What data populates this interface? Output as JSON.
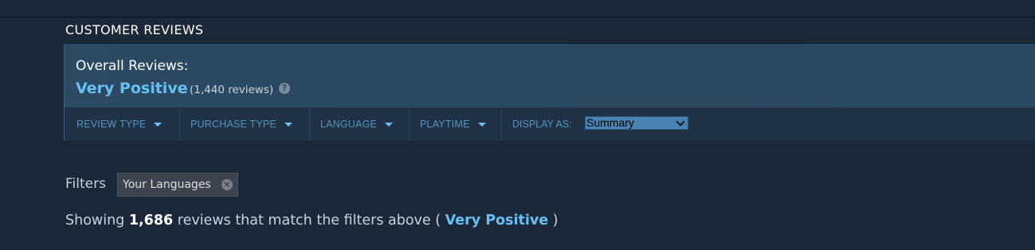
{
  "section": {
    "title": "CUSTOMER REVIEWS"
  },
  "summary": {
    "label": "Overall Reviews:",
    "rating": "Very Positive",
    "count": "(1,440 reviews)",
    "help_icon": "?",
    "rating_color": "#66c0f4"
  },
  "filter_bar": {
    "items": [
      {
        "label": "REVIEW TYPE"
      },
      {
        "label": "PURCHASE TYPE"
      },
      {
        "label": "LANGUAGE"
      },
      {
        "label": "PLAYTIME"
      }
    ],
    "display_label": "DISPLAY AS:",
    "display_value": "Summary"
  },
  "filters": {
    "label": "Filters",
    "chips": [
      {
        "label": "Your Languages",
        "close_icon": "×"
      }
    ]
  },
  "showing": {
    "prefix": "Showing ",
    "count": "1,686",
    "middle": " reviews that match the filters above ( ",
    "rating": "Very Positive",
    "suffix": " )"
  }
}
